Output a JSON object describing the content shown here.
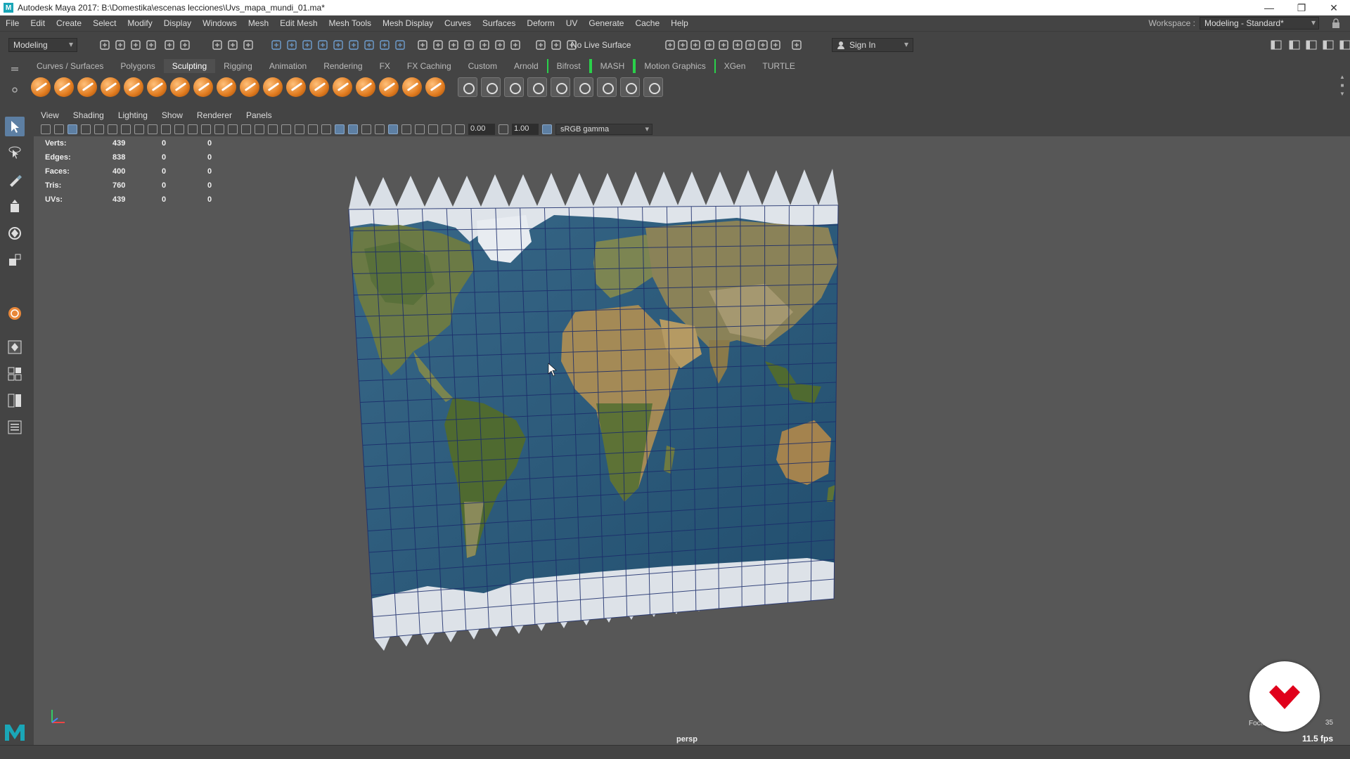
{
  "window": {
    "title": "Autodesk Maya 2017: B:\\Domestika\\escenas lecciones\\Uvs_mapa_mundi_01.ma*"
  },
  "menu": [
    "File",
    "Edit",
    "Create",
    "Select",
    "Modify",
    "Display",
    "Windows",
    "Mesh",
    "Edit Mesh",
    "Mesh Tools",
    "Mesh Display",
    "Curves",
    "Surfaces",
    "Deform",
    "UV",
    "Generate",
    "Cache",
    "Help"
  ],
  "workspace": {
    "label": "Workspace :",
    "value": "Modeling - Standard*"
  },
  "statusline": {
    "mode": "Modeling",
    "live_surface": "No Live Surface",
    "sign_in": "Sign In"
  },
  "shelf": {
    "tabs": [
      "Curves / Surfaces",
      "Polygons",
      "Sculpting",
      "Rigging",
      "Animation",
      "Rendering",
      "FX",
      "FX Caching",
      "Custom",
      "Arnold",
      "Bifrost",
      "MASH",
      "Motion Graphics",
      "XGen",
      "TURTLE"
    ],
    "active_tab": "Sculpting",
    "sculpt_tool_count": 18
  },
  "panel": {
    "menu": [
      "View",
      "Shading",
      "Lighting",
      "Show",
      "Renderer",
      "Panels"
    ],
    "exposure": "0.00",
    "gamma": "1.00",
    "color_space": "sRGB gamma"
  },
  "hud": {
    "rows": [
      {
        "label": "Verts:",
        "v1": "439",
        "v2": "0",
        "v3": "0"
      },
      {
        "label": "Edges:",
        "v1": "838",
        "v2": "0",
        "v3": "0"
      },
      {
        "label": "Faces:",
        "v1": "400",
        "v2": "0",
        "v3": "0"
      },
      {
        "label": "Tris:",
        "v1": "760",
        "v2": "0",
        "v3": "0"
      },
      {
        "label": "UVs:",
        "v1": "439",
        "v2": "0",
        "v3": "0"
      }
    ],
    "camera": "persp",
    "fps": "11.5 fps",
    "focal_label": "Foca",
    "focal_value": "35"
  },
  "colors": {
    "accent": "#5d7fa3",
    "ocean": "#2d5a7a",
    "land": "#6f7a45",
    "ice": "#d6dde5",
    "grid": "#1a2b6a",
    "domestika_red": "#e0001b"
  }
}
